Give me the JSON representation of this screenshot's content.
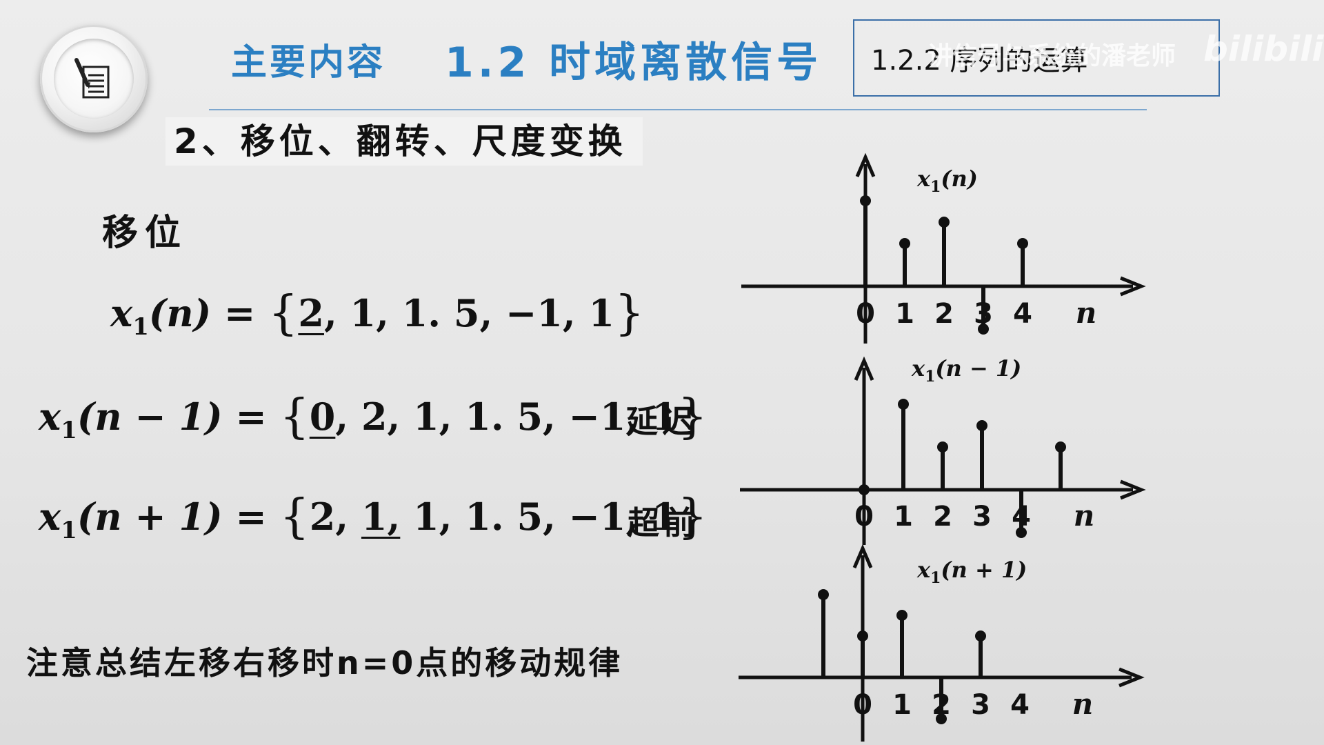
{
  "header": {
    "title": "主要内容",
    "main_title": "1.2 时域离散信号",
    "section": "1.2.2 序列的运算",
    "watermark": "讲信号与系统的潘老师",
    "watermark_logo": "bilibili"
  },
  "subtitle": "2、移位、翻转、尺度变换",
  "shift_label": "移位",
  "equations": [
    {
      "lhs_func": "x",
      "lhs_sub": "1",
      "lhs_arg": "(n)",
      "eq": " = ",
      "open": "{",
      "before": "",
      "underlined": "2",
      "after": ", 1, 1. 5, −1, 1",
      "close": "}",
      "tag": ""
    },
    {
      "lhs_func": "x",
      "lhs_sub": "1",
      "lhs_arg": "(n − 1)",
      "eq": " =  ",
      "open": "{",
      "before": "",
      "underlined": "0",
      "after": ", 2, 1, 1. 5, −1, 1",
      "close": "}",
      "tag": "延迟"
    },
    {
      "lhs_func": "x",
      "lhs_sub": "1",
      "lhs_arg": "(n + 1)",
      "eq": " = ",
      "open": "{",
      "before": "2, ",
      "underlined": "1,",
      "after": " 1, 1. 5, −1, 1",
      "close": "}",
      "tag": "超前"
    }
  ],
  "note": "注意总结左移右移时n=0点的移动规律",
  "chart_data": [
    {
      "type": "stem",
      "title_func": "x",
      "title_sub": "1",
      "title_arg": "(n)",
      "x": [
        0,
        1,
        2,
        3,
        4
      ],
      "values": [
        2,
        1,
        1.5,
        -1,
        1
      ],
      "x_tick_labels": [
        "0",
        "1",
        "2",
        "3",
        "4"
      ],
      "x_axis_label": "n"
    },
    {
      "type": "stem",
      "title_func": "x",
      "title_sub": "1",
      "title_arg": "(n − 1)",
      "x": [
        0,
        1,
        2,
        3,
        4,
        5
      ],
      "values": [
        0,
        2,
        1,
        1.5,
        -1,
        1
      ],
      "x_tick_labels": [
        "0",
        "1",
        "2",
        "3",
        "4"
      ],
      "x_axis_label": "n"
    },
    {
      "type": "stem",
      "title_func": "x",
      "title_sub": "1",
      "title_arg": "(n + 1)",
      "x": [
        -1,
        0,
        1,
        2,
        3
      ],
      "values": [
        2,
        1,
        1.5,
        -1,
        1
      ],
      "x_tick_labels": [
        "0",
        "1",
        "2",
        "3",
        "4"
      ],
      "x_axis_label": "n"
    }
  ],
  "colors": {
    "accent": "#2b7fc2",
    "box_border": "#3b6fa8",
    "divider": "#7da7cf",
    "ink": "#111111"
  }
}
